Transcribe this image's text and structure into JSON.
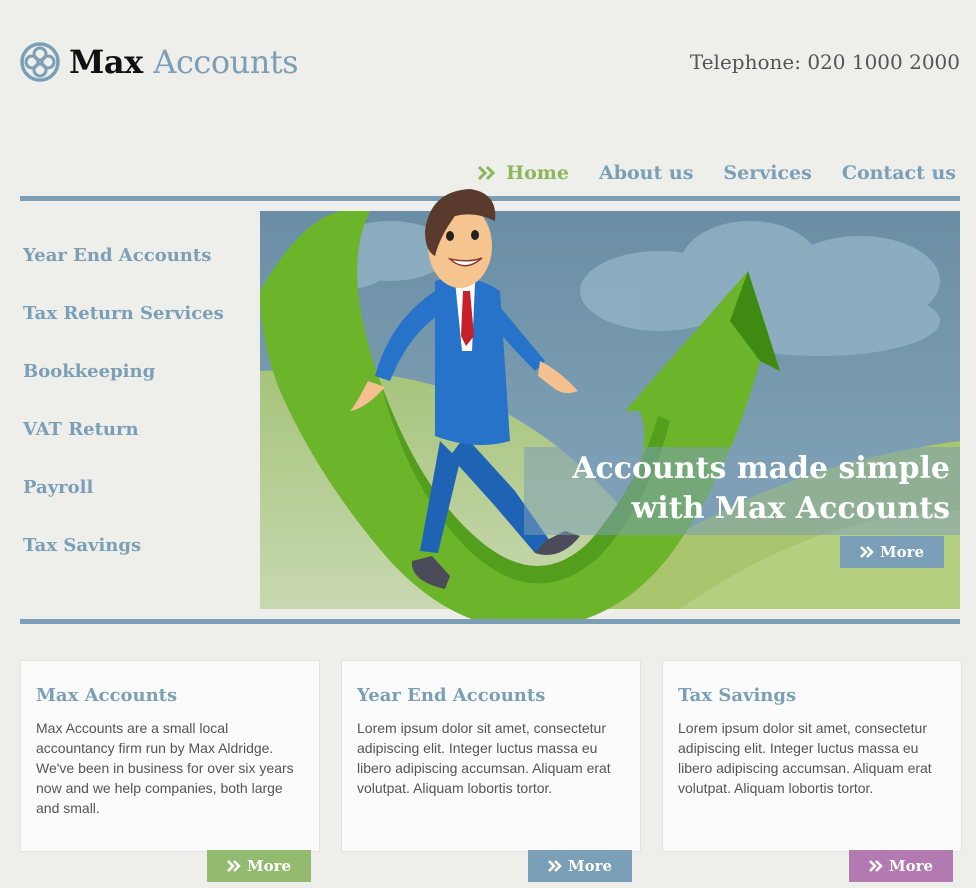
{
  "logo": {
    "word1": "Max",
    "word2": "Accounts",
    "icon": "knot-logo-icon"
  },
  "phone": "Telephone: 020 1000 2000",
  "nav": {
    "items": [
      {
        "label": "Home",
        "active": true
      },
      {
        "label": "About us"
      },
      {
        "label": "Services"
      },
      {
        "label": "Contact us"
      }
    ]
  },
  "sidebar": {
    "items": [
      {
        "label": "Year End Accounts"
      },
      {
        "label": "Tax Return Services"
      },
      {
        "label": "Bookkeeping"
      },
      {
        "label": "VAT Return"
      },
      {
        "label": "Payroll"
      },
      {
        "label": "Tax Savings"
      }
    ]
  },
  "hero": {
    "line1": "Accounts made simple",
    "line2": "with Max Accounts",
    "more_label": "More"
  },
  "cards": [
    {
      "title": "Max Accounts",
      "body": "Max Accounts are a small local accountancy firm run by Max Aldridge. We've been in business for over six years now and we help companies, both large and small.",
      "more_label": "More",
      "color": "#93bb6f"
    },
    {
      "title": "Year End Accounts",
      "body": "Lorem ipsum dolor sit amet, consectetur adipiscing elit. Integer luctus massa eu libero adipiscing accumsan. Aliquam erat volutpat. Aliquam lobortis tortor.",
      "more_label": "More",
      "color": "#7b9fb6"
    },
    {
      "title": "Tax Savings",
      "body": "Lorem ipsum dolor sit amet, consectetur adipiscing elit. Integer luctus massa eu libero adipiscing accumsan. Aliquam erat volutpat. Aliquam lobortis tortor.",
      "more_label": "More",
      "color": "#b27ab0"
    }
  ],
  "colors": {
    "accent_blue": "#7b9fb6",
    "accent_green": "#8cb55c",
    "accent_purple": "#b27ab0",
    "background": "#eeeeea"
  }
}
